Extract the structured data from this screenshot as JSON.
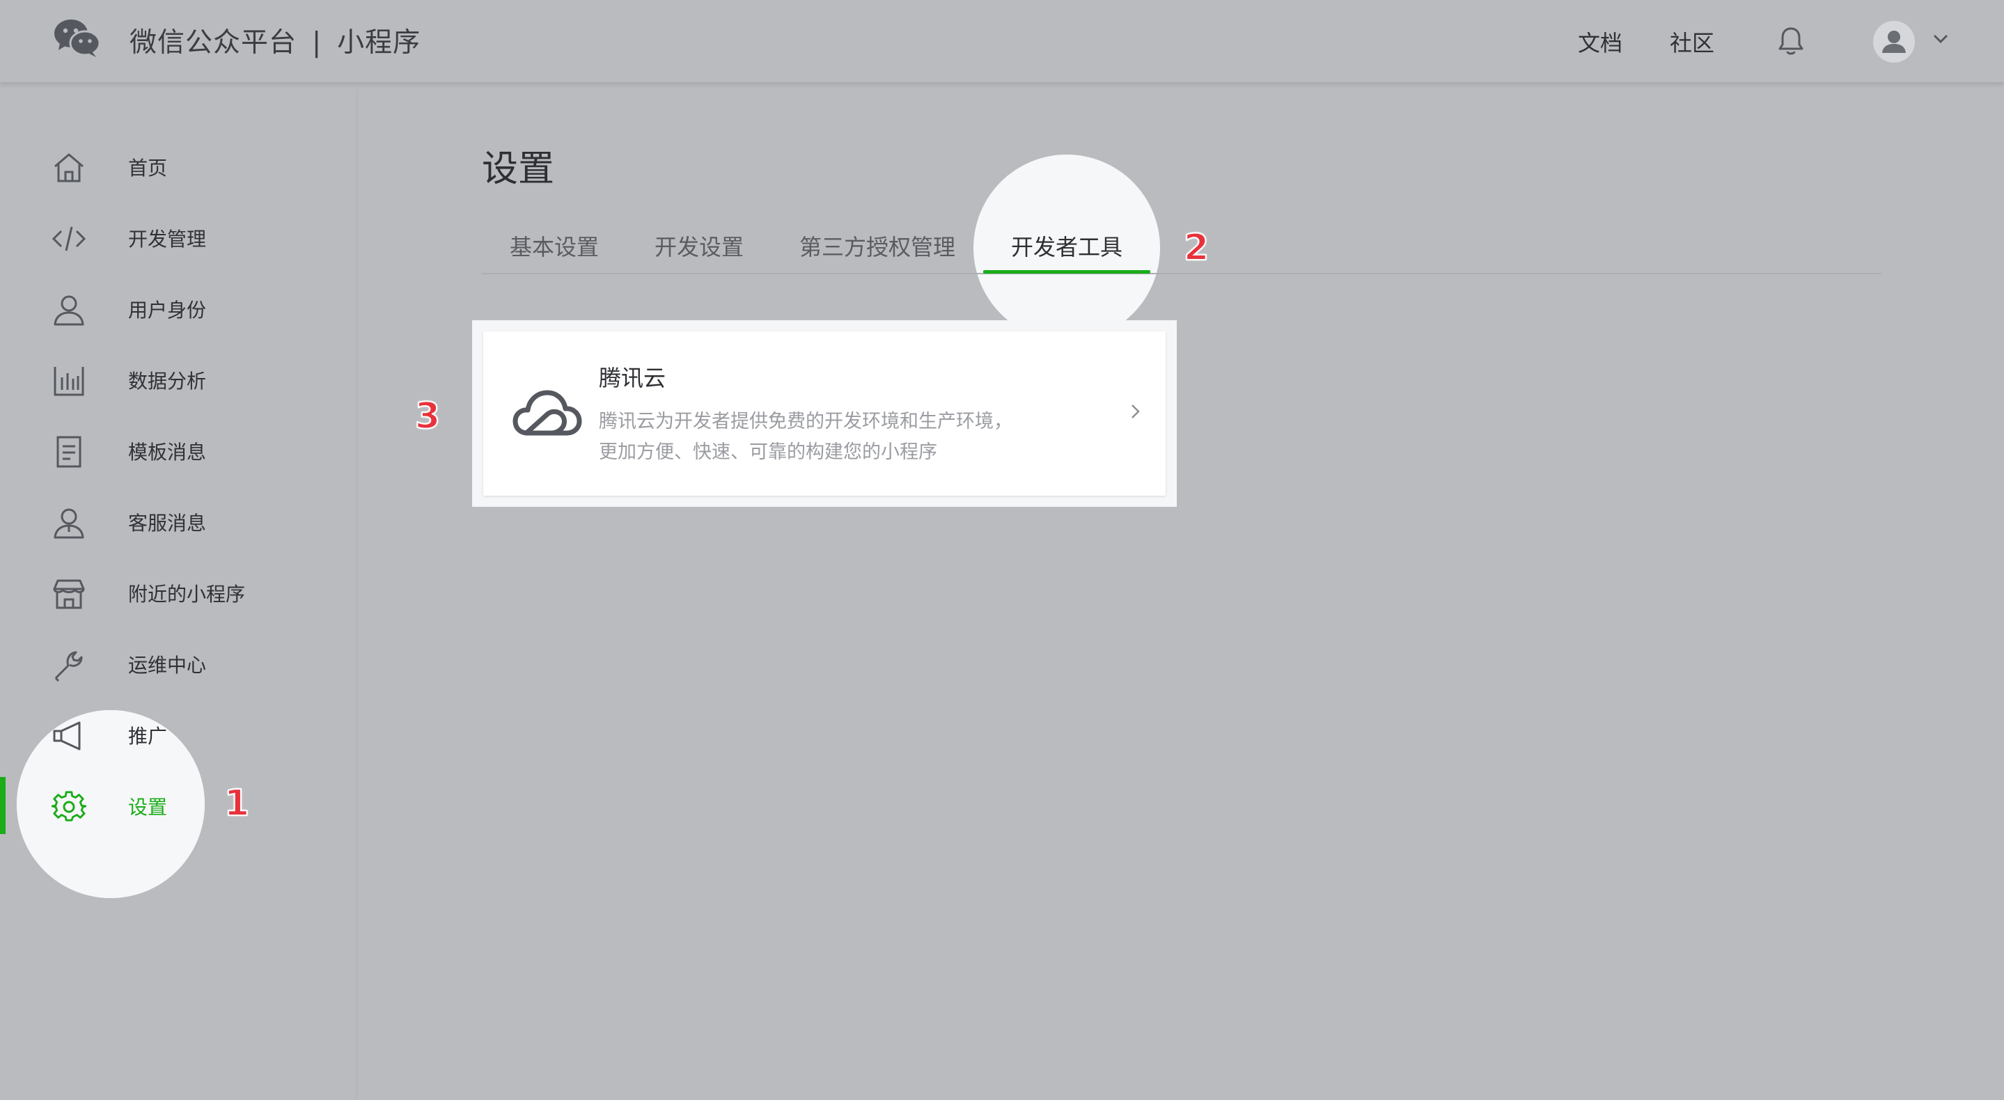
{
  "header": {
    "brand_name": "微信公众平台",
    "brand_sep": "|",
    "brand_product": "小程序",
    "links": [
      {
        "label": "文档"
      },
      {
        "label": "社区"
      }
    ],
    "bell_icon": "bell-icon",
    "avatar_icon": "user-avatar-icon"
  },
  "sidebar": {
    "items": [
      {
        "label": "首页",
        "icon": "home-icon"
      },
      {
        "label": "开发管理",
        "icon": "code-icon"
      },
      {
        "label": "用户身份",
        "icon": "user-icon"
      },
      {
        "label": "数据分析",
        "icon": "bar-chart-icon"
      },
      {
        "label": "模板消息",
        "icon": "document-icon"
      },
      {
        "label": "客服消息",
        "icon": "customer-service-icon"
      },
      {
        "label": "附近的小程序",
        "icon": "store-icon"
      },
      {
        "label": "运维中心",
        "icon": "wrench-icon"
      },
      {
        "label": "推广",
        "icon": "megaphone-icon"
      },
      {
        "label": "设置",
        "icon": "gear-icon",
        "active": true
      }
    ]
  },
  "main": {
    "title": "设置",
    "tabs": [
      {
        "label": "基本设置"
      },
      {
        "label": "开发设置"
      },
      {
        "label": "第三方授权管理"
      },
      {
        "label": "开发者工具",
        "active": true
      }
    ],
    "card": {
      "icon": "cloud-icon",
      "title": "腾讯云",
      "description": "腾讯云为开发者提供免费的开发环境和生产环境，更加方便、快速、可靠的构建您的小程序"
    }
  },
  "steps": [
    "1",
    "2",
    "3"
  ],
  "colors": {
    "accent": "#1aad19",
    "step_marker": "#e8323c",
    "overlay": "#b9bbbf"
  }
}
